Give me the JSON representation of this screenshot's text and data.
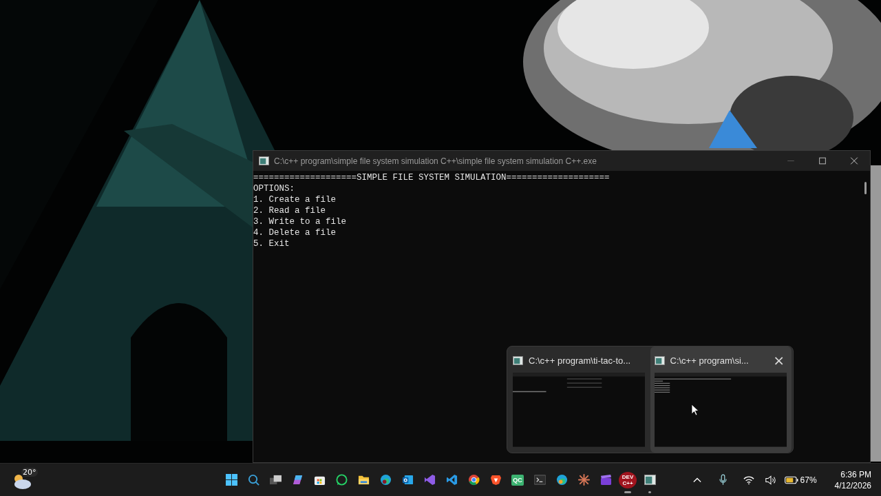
{
  "console_window": {
    "title": "C:\\c++ program\\simple file system simulation C++\\simple file system simulation C++.exe",
    "lines": [
      "====================SIMPLE FILE SYSTEM SIMULATION====================",
      "OPTIONS:",
      "1. Create a file",
      "2. Read a file",
      "3. Write to a file",
      "4. Delete a file",
      "5. Exit"
    ]
  },
  "taskbar_preview": {
    "items": [
      {
        "title": "C:\\c++ program\\ti-tac-to...",
        "hovered": false
      },
      {
        "title": "C:\\c++ program\\si...",
        "hovered": true,
        "close": "×"
      }
    ]
  },
  "taskbar": {
    "weather": {
      "temperature": "20°"
    },
    "apps": [
      {
        "kind": "start",
        "open": false
      },
      {
        "kind": "search",
        "open": false
      },
      {
        "kind": "taskview",
        "open": false
      },
      {
        "kind": "m365",
        "open": false
      },
      {
        "kind": "store",
        "open": false
      },
      {
        "kind": "chat",
        "open": false
      },
      {
        "kind": "folder",
        "open": false
      },
      {
        "kind": "browser-dev",
        "open": false
      },
      {
        "kind": "mail",
        "open": false
      },
      {
        "kind": "vs",
        "open": false
      },
      {
        "kind": "code",
        "open": false
      },
      {
        "kind": "chrome",
        "open": false
      },
      {
        "kind": "lion",
        "open": false
      },
      {
        "kind": "label",
        "label": "QC",
        "open": false
      },
      {
        "kind": "terminal",
        "open": false
      },
      {
        "kind": "browser",
        "open": false
      },
      {
        "kind": "star",
        "open": false
      },
      {
        "kind": "clip",
        "open": false
      },
      {
        "kind": "dev",
        "label": "DEV C++",
        "open": true,
        "focused": true
      },
      {
        "kind": "console",
        "open": true,
        "focused": false
      }
    ],
    "tray": {
      "battery": "67%",
      "time": "6:36 PM",
      "date": "4/12/2026"
    }
  }
}
